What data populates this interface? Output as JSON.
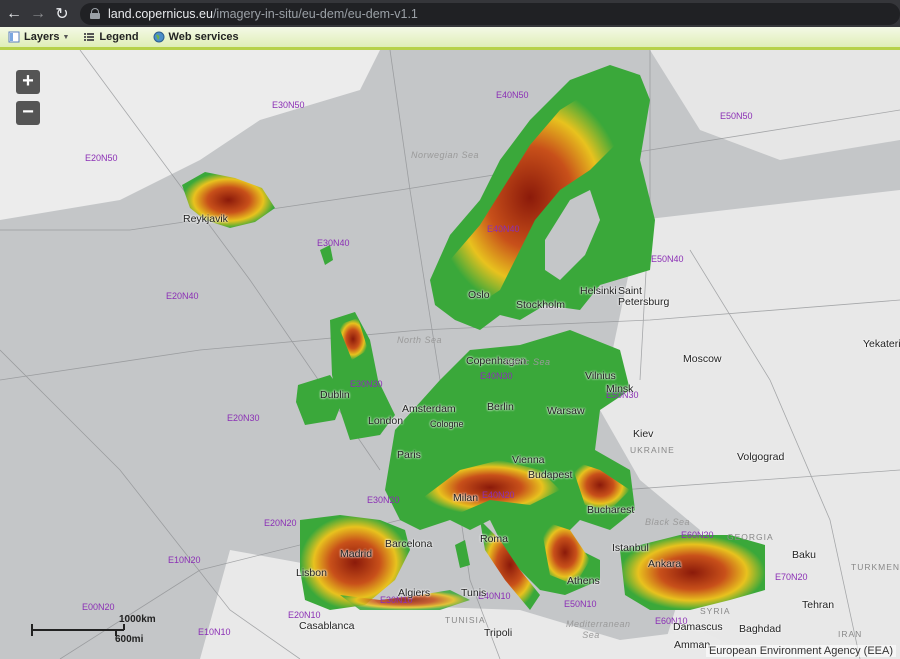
{
  "browser": {
    "url_host": "land.copernicus.eu",
    "url_path": "/imagery-in-situ/eu-dem/eu-dem-v1.1",
    "back_icon": "arrow-left-icon",
    "forward_icon": "arrow-right-icon",
    "reload_icon": "reload-icon"
  },
  "toolbar": {
    "layers": "Layers",
    "legend": "Legend",
    "web_services": "Web services"
  },
  "map": {
    "zoom_in": "+",
    "zoom_out": "−",
    "grid_labels": [
      "E30N50",
      "E40N50",
      "E50N50",
      "E20N50",
      "E30N40",
      "E40N40",
      "E50N40",
      "E20N40",
      "E30N30",
      "E40N30",
      "E50N30",
      "E20N30",
      "E30N20",
      "E40N20",
      "E60N20",
      "E20N20",
      "E70N20",
      "E10N20",
      "E00N20",
      "E20N10",
      "E30N10",
      "E40N10",
      "E50N10",
      "E60N10",
      "E10N10"
    ],
    "cities": [
      "Reykjavik",
      "Oslo",
      "Stockholm",
      "Helsinki",
      "Saint Petersburg",
      "Copenhagen",
      "Dublin",
      "Amsterdam",
      "Berlin",
      "Warsaw",
      "Vilnius",
      "Minsk",
      "Moscow",
      "London",
      "Cologne",
      "Paris",
      "Kiev",
      "Vienna",
      "Budapest",
      "Volgograd",
      "Milan",
      "Bucharest",
      "Madrid",
      "Barcelona",
      "Roma",
      "Istanbul",
      "Ankara",
      "Baku",
      "Lisbon",
      "Algiers",
      "Tunis",
      "Athens",
      "Tehran",
      "Casablanca",
      "Tripoli",
      "Damascus",
      "Baghdad",
      "Amman",
      "Yekateri"
    ],
    "seas": [
      "Norwegian Sea",
      "North Sea",
      "Baltic Sea",
      "Black Sea",
      "Mediterranean Sea"
    ],
    "countries": [
      "UKRAINE",
      "TURKMENIST",
      "TUNISIA",
      "SYRIA",
      "IRAN",
      "GEORGIA"
    ],
    "scale_km": "1000km",
    "scale_mi": "600mi",
    "attribution": "European Environment Agency (EEA)"
  }
}
